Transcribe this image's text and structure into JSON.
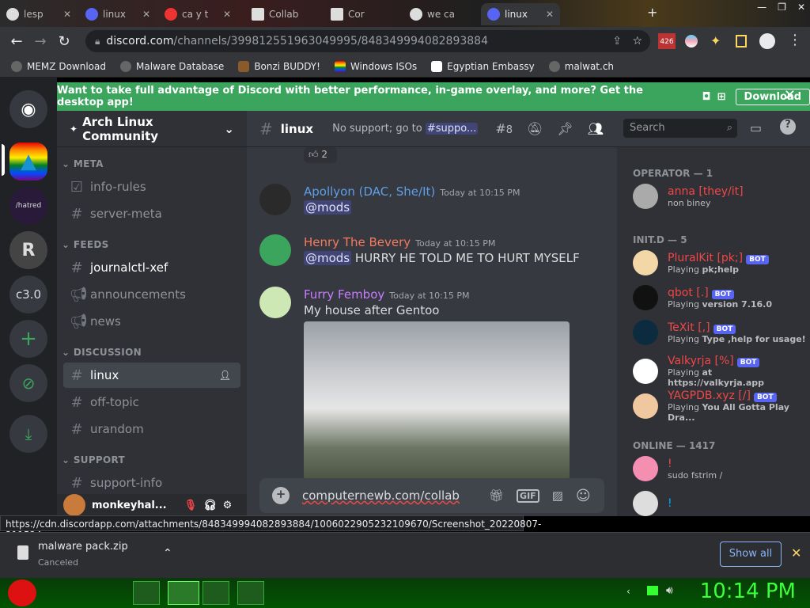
{
  "browser": {
    "tabs": [
      {
        "label": "lesp"
      },
      {
        "label": "linux"
      },
      {
        "label": "ca y t"
      },
      {
        "label": "Collab"
      },
      {
        "label": "Cor"
      },
      {
        "label": "we ca"
      },
      {
        "label": "linux"
      }
    ],
    "url_domain": "discord.com",
    "url_path": "/channels/399812551963049995/848349994082893884",
    "badge": "426",
    "bookmarks": [
      {
        "label": "MEMZ Download"
      },
      {
        "label": "Malware Database"
      },
      {
        "label": "Bonzi BUDDY!"
      },
      {
        "label": "Windows ISOs"
      },
      {
        "label": "Egyptian Embassy"
      },
      {
        "label": "malwat.ch"
      }
    ]
  },
  "banner": {
    "text": "Want to take full advantage of Discord with better performance, in-game overlay, and more? Get the desktop app!",
    "download": "Download"
  },
  "servers": [
    {
      "label": ""
    },
    {
      "label": "/hatred"
    },
    {
      "label": "R"
    },
    {
      "label": "c3.0"
    }
  ],
  "guild": {
    "name": "Arch Linux Community"
  },
  "categories": {
    "meta": "META",
    "feeds": "FEEDS",
    "discussion": "DISCUSSION",
    "support": "SUPPORT"
  },
  "channels": {
    "info_rules": "info-rules",
    "server_meta": "server-meta",
    "journalctl": "journalctl-xef",
    "announcements": "announcements",
    "news": "news",
    "linux": "linux",
    "offtopic": "off-topic",
    "urandom": "urandom",
    "support_info": "support-info"
  },
  "user": {
    "name": "monkeyhal..."
  },
  "chat": {
    "channel": "linux",
    "topic": "No support; go to",
    "topic_chan": "#suppo...",
    "threads": "8",
    "search": "Search",
    "reaction_count": "2"
  },
  "messages": [
    {
      "author": "Apollyon (DAC, She/It)",
      "color": "#5f9ee8",
      "time": "Today at 10:15 PM",
      "mention": "@mods",
      "text": ""
    },
    {
      "author": "Henry The Bevery",
      "color": "#f47b5e",
      "time": "Today at 10:15 PM",
      "mention": "@mods",
      "text": "HURRY HE TOLD ME TO HURT MYSELF"
    },
    {
      "author": "Furry Femboy",
      "color": "#c77dff",
      "time": "Today at 10:15 PM",
      "mention": "",
      "text": "My house after Gentoo"
    }
  ],
  "composer": {
    "text": "computernewb.com/collab"
  },
  "members": {
    "operator_header": "OPERATOR — 1",
    "initd_header": "INIT.D — 5",
    "online_header": "ONLINE — 1417",
    "bot_label": "BOT",
    "list": [
      {
        "name": "anna [they/it]",
        "color": "#f04747",
        "status": "non biney",
        "status_strong": ""
      },
      {
        "name": "PluralKit [pk;]",
        "color": "#f04747",
        "status": "Playing",
        "status_strong": "pk;help"
      },
      {
        "name": "qbot [.]",
        "color": "#f04747",
        "status": "Playing",
        "status_strong": "version 7.16.0"
      },
      {
        "name": "TeXit [,]",
        "color": "#f04747",
        "status": "Playing",
        "status_strong": "Type ,help for usage!"
      },
      {
        "name": "Valkyrja [%]",
        "color": "#f04747",
        "status": "Playing",
        "status_strong": "at https://valkyrja.app"
      },
      {
        "name": "YAGPDB.xyz [/]",
        "color": "#f04747",
        "status": "Playing",
        "status_strong": "You All Gotta Play Dra..."
      },
      {
        "name": "!",
        "color": "#f04747",
        "status": "sudo fstrim /",
        "status_strong": ""
      },
      {
        "name": "!",
        "color": "#00b0f4",
        "status": "",
        "status_strong": ""
      }
    ]
  },
  "statusbar": "https://cdn.discordapp.com/attachments/848349994082893884/1006022905232109670/Screenshot_20220807-211524.png",
  "download": {
    "file": "malware pack.zip",
    "state": "Canceled",
    "show_all": "Show all"
  },
  "taskbar": {
    "clock": "10:14 PM"
  }
}
